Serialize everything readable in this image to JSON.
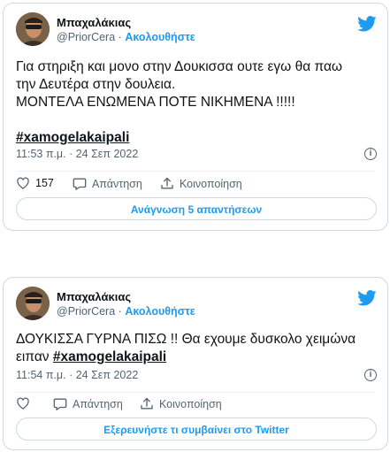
{
  "tweets": [
    {
      "author": {
        "name": "Μπαχαλάκιας",
        "handle": "@PriorCera",
        "separator": "·",
        "follow_label": "Ακολουθήστε"
      },
      "text_lines": [
        "Για στηριξη και μονο στην Δουκισσα ουτε εγω θα παω",
        "την Δευτέρα στην δουλεια.",
        "ΜΟΝΤΕΛΑ ΕΝΩΜΕΝΑ ΠΟΤΕ ΝΙΚΗΜΕΝΑ !!!!!"
      ],
      "hashtag": "#xamogelakaipali",
      "timestamp": "11:53 π.μ. · 24 Σεπ 2022",
      "like_count": "157",
      "reply_label": "Απάντηση",
      "share_label": "Κοινοποίηση",
      "bottom_button": "Ανάγνωση 5 απαντήσεων"
    },
    {
      "author": {
        "name": "Μπαχαλάκιας",
        "handle": "@PriorCera",
        "separator": "·",
        "follow_label": "Ακολουθήστε"
      },
      "text_line1": "ΔΟΥΚΙΣΣΑ ΓΥΡΝΑ ΠΙΣΩ !! Θα εχουμε δυσκολο χειμώνα",
      "text_line2_prefix": "ειπαν",
      "hashtag": "#xamogelakaipali",
      "timestamp": "11:54 π.μ. · 24 Σεπ 2022",
      "reply_label": "Απάντηση",
      "share_label": "Κοινοποίηση",
      "bottom_button": "Εξερευνήστε τι συμβαίνει στο Twitter"
    }
  ],
  "icons": {
    "twitter_logo": "twitter-bird-icon",
    "info": "info-icon",
    "like": "heart-icon",
    "reply": "reply-bubble-icon",
    "share": "share-upload-icon"
  },
  "colors": {
    "accent": "#1d9bf0",
    "text": "#0f1419",
    "secondary": "#536471",
    "border": "#cfd9de"
  }
}
